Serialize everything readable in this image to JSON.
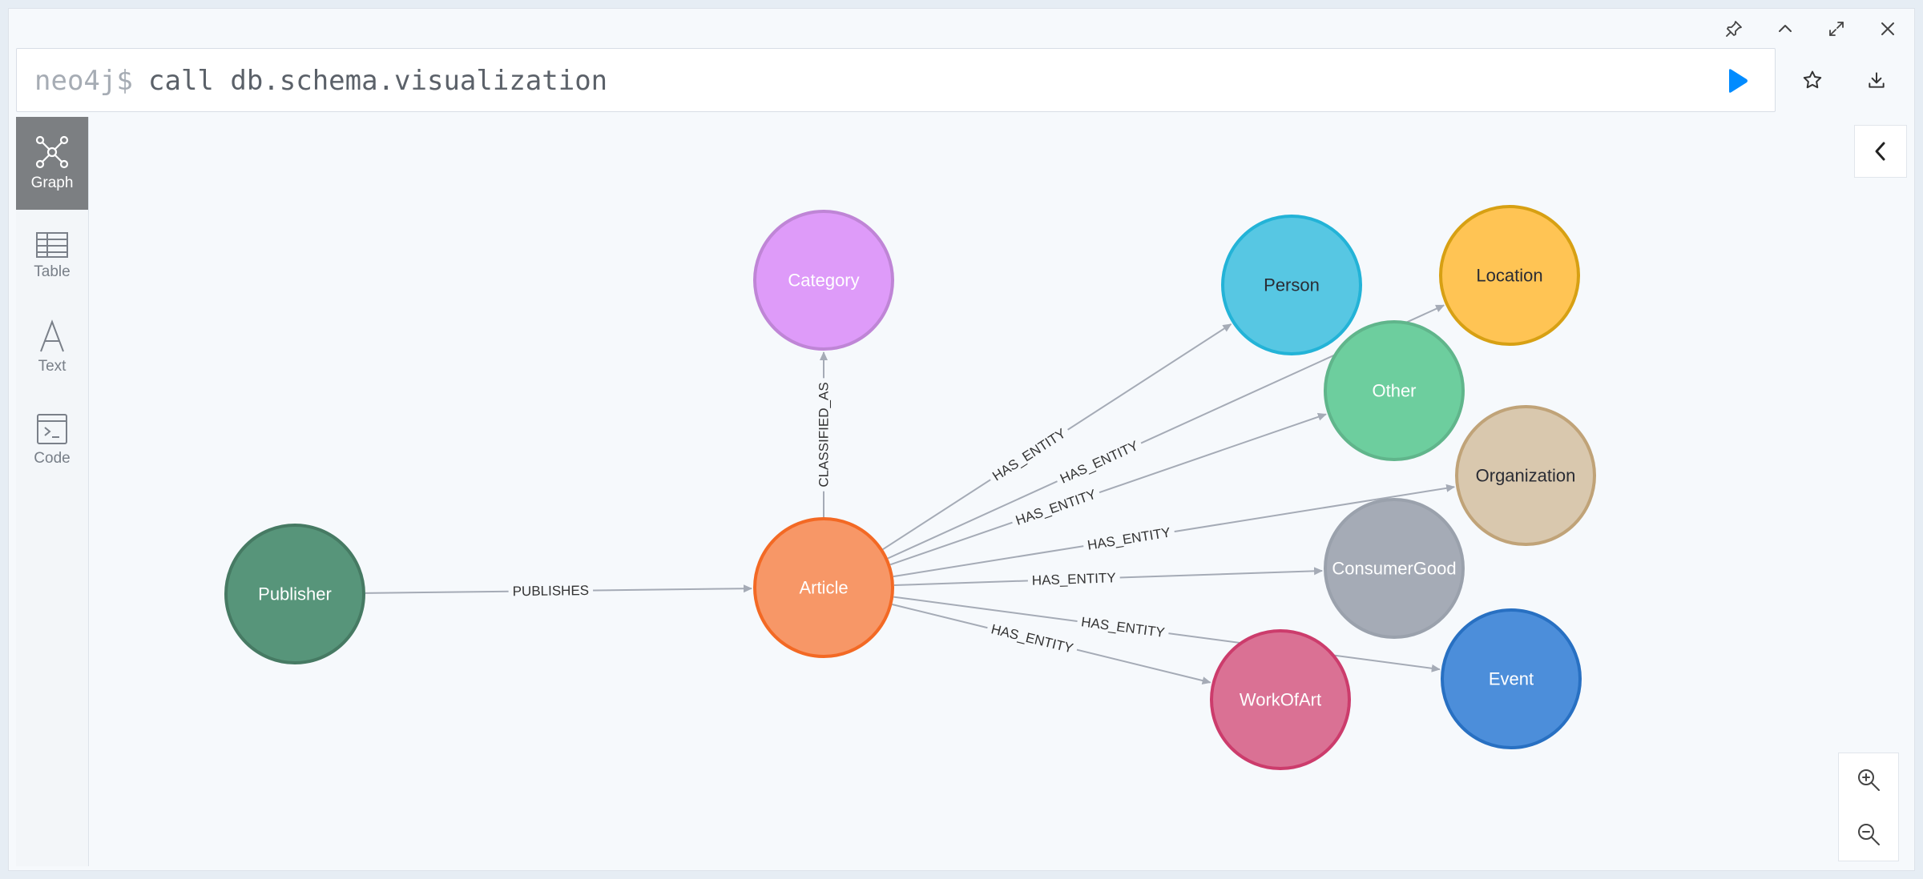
{
  "window": {
    "pin_icon": "pin-icon",
    "collapse_icon": "chevron-up-icon",
    "fullscreen_icon": "expand-icon",
    "close_icon": "close-icon"
  },
  "editor": {
    "prompt": "neo4j$",
    "query": "call db.schema.visualization",
    "run_icon": "play-icon",
    "favorite_icon": "star-icon",
    "download_icon": "download-icon",
    "accent_color": "#018bff"
  },
  "views": [
    {
      "label": "Graph",
      "icon": "graph-icon",
      "active": true
    },
    {
      "label": "Table",
      "icon": "table-icon",
      "active": false
    },
    {
      "label": "Text",
      "icon": "text-icon",
      "active": false
    },
    {
      "label": "Code",
      "icon": "code-icon",
      "active": false
    }
  ],
  "graph": {
    "nodes": [
      {
        "id": "publisher",
        "label": "Publisher",
        "fill": "#57957a",
        "stroke": "#467a63",
        "text": "#ffffff"
      },
      {
        "id": "article",
        "label": "Article",
        "fill": "#f79767",
        "stroke": "#f36924",
        "text": "#ffffff"
      },
      {
        "id": "category",
        "label": "Category",
        "fill": "#de9bf9",
        "stroke": "#bf85d6",
        "text": "#ffffff"
      },
      {
        "id": "person",
        "label": "Person",
        "fill": "#57c7e3",
        "stroke": "#23b3d7",
        "text": "#2a2c34"
      },
      {
        "id": "location",
        "label": "Location",
        "fill": "#ffc454",
        "stroke": "#d7a013",
        "text": "#2a2c34"
      },
      {
        "id": "other",
        "label": "Other",
        "fill": "#6dce9e",
        "stroke": "#60b58b",
        "text": "#ffffff"
      },
      {
        "id": "organization",
        "label": "Organization",
        "fill": "#d9c8ae",
        "stroke": "#c0a378",
        "text": "#2a2c34"
      },
      {
        "id": "consumergood",
        "label": "ConsumerGood",
        "fill": "#a5abb6",
        "stroke": "#9aa1ac",
        "text": "#ffffff"
      },
      {
        "id": "event",
        "label": "Event",
        "fill": "#4c8eda",
        "stroke": "#2870c2",
        "text": "#ffffff"
      },
      {
        "id": "workofart",
        "label": "WorkOfArt",
        "fill": "#da7194",
        "stroke": "#cc3c6c",
        "text": "#ffffff"
      }
    ],
    "relationships": [
      {
        "from": "publisher",
        "to": "article",
        "type": "PUBLISHES"
      },
      {
        "from": "article",
        "to": "category",
        "type": "CLASSIFIED_AS"
      },
      {
        "from": "article",
        "to": "person",
        "type": "HAS_ENTITY"
      },
      {
        "from": "article",
        "to": "location",
        "type": "HAS_ENTITY"
      },
      {
        "from": "article",
        "to": "other",
        "type": "HAS_ENTITY"
      },
      {
        "from": "article",
        "to": "organization",
        "type": "HAS_ENTITY"
      },
      {
        "from": "article",
        "to": "consumergood",
        "type": "HAS_ENTITY"
      },
      {
        "from": "article",
        "to": "event",
        "type": "HAS_ENTITY"
      },
      {
        "from": "article",
        "to": "workofart",
        "type": "HAS_ENTITY"
      }
    ]
  },
  "zoom": {
    "in_icon": "zoom-in-icon",
    "out_icon": "zoom-out-icon"
  },
  "sidebar_toggle_icon": "chevron-left-icon"
}
